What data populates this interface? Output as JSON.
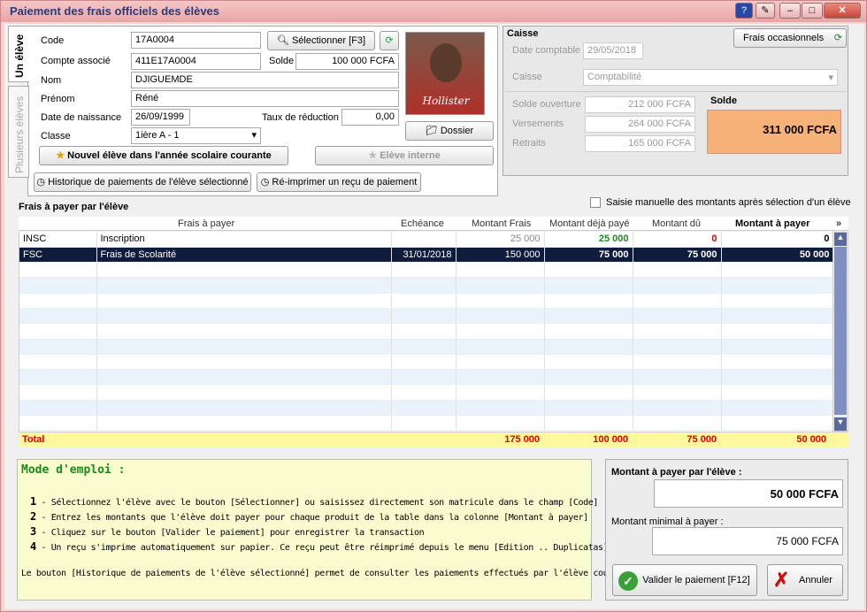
{
  "window": {
    "title": "Paiement des frais officiels des élèves"
  },
  "tabs": {
    "one": "Un élève",
    "many": "Plusieurs élèves"
  },
  "student": {
    "code_label": "Code",
    "code_value": "17A0004",
    "select_button": "Sélectionner [F3]",
    "account_label": "Compte associé",
    "account_value": "411E17A0004",
    "balance_label": "Solde",
    "balance_value": "100 000 FCFA",
    "lastname_label": "Nom",
    "lastname_value": "DJIGUEMDE",
    "firstname_label": "Prénom",
    "firstname_value": "Réné",
    "birth_label": "Date de naissance",
    "birth_value": "26/09/1999",
    "discount_label": "Taux de réduction",
    "discount_value": "0,00",
    "class_label": "Classe",
    "class_value": "1ière A - 1",
    "new_student_button": "Nouvel élève dans l'année scolaire courante",
    "internal_button": "Elève interne",
    "dossier_button": "Dossier",
    "history_button": "Historique de paiements de l'élève sélectionné",
    "reprint_button": "Ré-imprimer un reçu de paiement"
  },
  "caisse": {
    "title": "Caisse",
    "occasional_button": "Frais occasionnels",
    "date_label": "Date comptable",
    "date_value": "29/05/2018",
    "caisse_label": "Caisse",
    "caisse_value": "Comptabilité",
    "opening_label": "Solde ouverture",
    "opening_value": "212 000 FCFA",
    "deposits_label": "Versements",
    "deposits_value": "264 000 FCFA",
    "withdrawals_label": "Retraits",
    "withdrawals_value": "165 000 FCFA",
    "solde_label": "Solde",
    "solde_value": "311 000 FCFA"
  },
  "manual_checkbox_label": "Saisie manuelle des montants après sélection d'un élève",
  "fees": {
    "section_title": "Frais à payer par l'élève",
    "columns": [
      "Frais à payer",
      "Echéance",
      "Montant Frais",
      "Montant déjà payé",
      "Montant dû",
      "Montant à payer"
    ],
    "rows": [
      {
        "code": "INSC",
        "name": "Inscription",
        "due": "",
        "amount": "25 000",
        "paid": "25 000",
        "owed": "0",
        "topay": "0"
      },
      {
        "code": "FSC",
        "name": "Frais de Scolarité",
        "due": "31/01/2018",
        "amount": "150 000",
        "paid": "75 000",
        "owed": "75 000",
        "topay": "50 000"
      }
    ],
    "total": {
      "label": "Total",
      "amount": "175 000",
      "paid": "100 000",
      "owed": "75 000",
      "topay": "50 000"
    }
  },
  "help": {
    "title": "Mode d'emploi :",
    "steps": [
      {
        "n": "1",
        "text": "- Sélectionnez l'élève avec le bouton [Sélectionner] ou saisissez directement son matricule dans le champ [Code]"
      },
      {
        "n": "2",
        "text": "- Entrez les montants que l'élève doit payer pour chaque produit de la table dans la colonne [Montant à payer]"
      },
      {
        "n": "3",
        "text": "- Cliquez sur le bouton [Valider le paiement] pour enregistrer la transaction"
      },
      {
        "n": "4",
        "text": "- Un reçu s'imprime automatiquement sur papier. Ce reçu peut être réimprimé depuis le menu [Edition .. Duplicatas]"
      }
    ],
    "note": "Le bouton [Historique de paiements de l'élève sélectionné] permet de consulter les paiements effectués par l'élève courant."
  },
  "payment": {
    "amount_label": "Montant à payer par l'élève :",
    "amount_value": "50 000 FCFA",
    "min_label": "Montant minimal à payer :",
    "min_value": "75 000 FCFA",
    "validate_button": "Valider le paiement [F12]",
    "cancel_button": "Annuler"
  },
  "colors": {
    "paid_green": "#1a8a1a",
    "owed_red": "#e00000",
    "total_red": "#e00000",
    "solde_bg": "#f7b27a",
    "help_bg": "#fbfbd0"
  }
}
